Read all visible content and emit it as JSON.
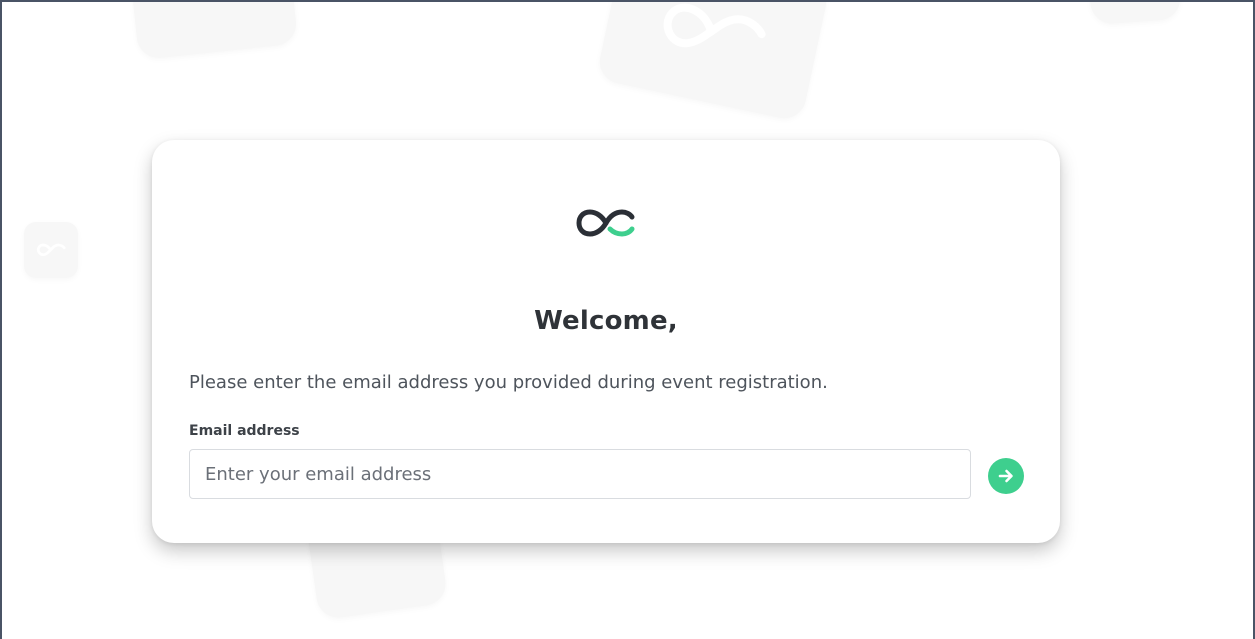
{
  "card": {
    "title": "Welcome,",
    "description": "Please enter the email address you provided during event registration.",
    "email_label": "Email address",
    "email_placeholder": "Enter your email address",
    "email_value": ""
  },
  "icons": {
    "logo": "brand-logo-icon",
    "submit": "arrow-right-icon",
    "background": "brand-logo-tile-icon"
  },
  "colors": {
    "accent": "#3ecf8e",
    "logo_dark": "#2b2f36",
    "frame_border": "#4a5466"
  }
}
